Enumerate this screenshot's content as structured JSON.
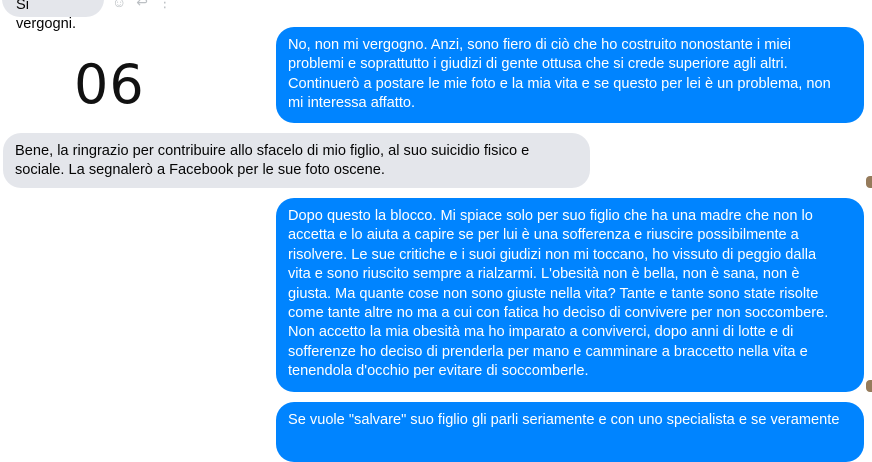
{
  "conversation": {
    "messages": [
      {
        "side": "incoming",
        "text": "Si vergogni."
      },
      {
        "side": "outgoing",
        "lines": [
          "No, non mi vergogno. Anzi, sono fiero di ciò che ho costruito nonostante i miei",
          "problemi e soprattutto i giudizi di gente ottusa che si crede superiore agli altri.",
          "Continuerò a postare le mie foto e la mia vita e se questo per lei è un problema, non",
          "mi interessa affatto."
        ]
      },
      {
        "side": "incoming",
        "lines": [
          "Bene, la ringrazio per contribuire allo sfacelo di mio figlio, al suo suicidio fisico e",
          "sociale. La segnalerò a Facebook per le sue foto oscene."
        ]
      },
      {
        "side": "outgoing",
        "lines": [
          "Dopo questo la blocco. Mi spiace solo per suo figlio che ha una madre che non lo",
          "accetta e lo aiuta a capire se per lui è una sofferenza e riuscire possibilmente a",
          "risolvere. Le sue critiche e i suoi giudizi non mi toccano, ho vissuto di peggio dalla",
          "vita e sono riuscito sempre a rialzarmi. L'obesità non è bella, non è sana, non è",
          "giusta. Ma quante cose non sono giuste nella vita? Tante e tante sono state risolte",
          "come tante altre no ma a cui con fatica ho deciso di convivere per non soccombere.",
          "Non accetto la mia obesità ma ho imparato a conviverci, dopo anni di lotte e di",
          "sofferenze ho deciso di prenderla per mano e camminare a braccetto nella vita e",
          "tenendola d'occhio per evitare di soccomberle."
        ]
      },
      {
        "side": "outgoing",
        "lines": [
          "Se vuole \"salvare\" suo figlio gli parli seriamente e con uno specialista e se veramente"
        ]
      }
    ]
  },
  "overlay": {
    "label": "06"
  },
  "icons": {
    "react": "smiley-icon",
    "reply": "reply-arrow-icon",
    "more": "more-dots-icon"
  },
  "colors": {
    "outgoing": "#0084ff",
    "incoming": "#e4e6eb"
  }
}
